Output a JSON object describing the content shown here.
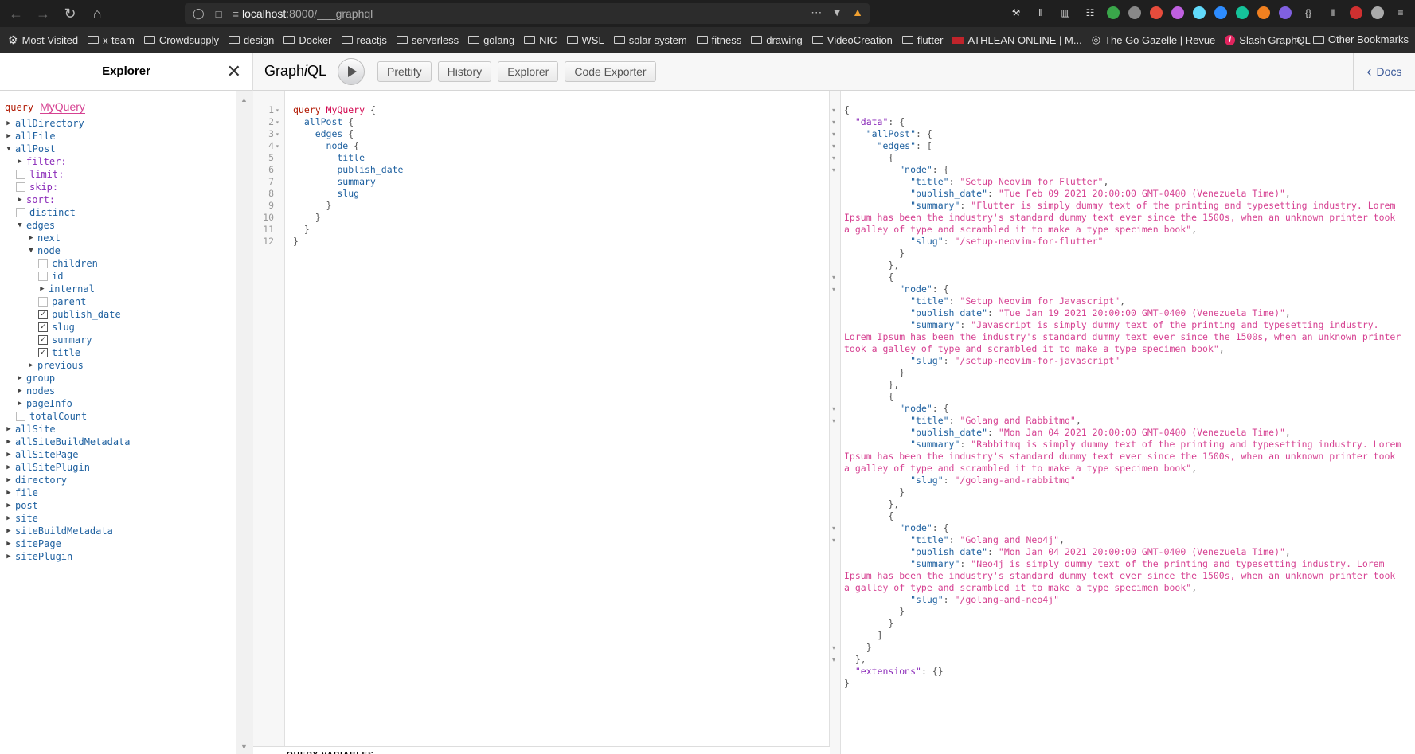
{
  "browser": {
    "url_host": "localhost",
    "url_path": ":8000/___graphql",
    "extensions": [
      "wrench-icon",
      "library-icon",
      "sidebar-icon",
      "reader-icon",
      "green-ext-icon",
      "shield-ext-icon",
      "x-ext-icon",
      "ring-ext-icon",
      "react-ext-icon",
      "zoom-ext-icon",
      "grammarly-icon",
      "orange-ext-icon",
      "purple-ext-icon",
      "json-ext-icon",
      "bars-ext-icon",
      "red-ext-icon",
      "circle-ext-icon",
      "menu-icon"
    ]
  },
  "bookmarks": {
    "items": [
      {
        "label": "Most Visited",
        "icon": "gear-icon"
      },
      {
        "label": "x-team",
        "icon": "folder-icon"
      },
      {
        "label": "Crowdsupply",
        "icon": "folder-icon"
      },
      {
        "label": "design",
        "icon": "folder-icon"
      },
      {
        "label": "Docker",
        "icon": "folder-icon"
      },
      {
        "label": "reactjs",
        "icon": "folder-icon"
      },
      {
        "label": "serverless",
        "icon": "folder-icon"
      },
      {
        "label": "golang",
        "icon": "folder-icon"
      },
      {
        "label": "NIC",
        "icon": "folder-icon"
      },
      {
        "label": "WSL",
        "icon": "folder-icon"
      },
      {
        "label": "solar system",
        "icon": "folder-icon"
      },
      {
        "label": "fitness",
        "icon": "folder-icon"
      },
      {
        "label": "drawing",
        "icon": "folder-icon"
      },
      {
        "label": "VideoCreation",
        "icon": "folder-icon"
      },
      {
        "label": "flutter",
        "icon": "folder-icon"
      },
      {
        "label": "ATHLEAN ONLINE | M...",
        "icon": "athlean-icon"
      },
      {
        "label": "The Go Gazelle | Revue",
        "icon": "globe-icon"
      },
      {
        "label": "Slash GraphQL",
        "icon": "slash-icon"
      }
    ],
    "other_label": "Other Bookmarks"
  },
  "explorer": {
    "title": "Explorer",
    "query_keyword": "query",
    "query_name": "MyQuery",
    "tree": [
      {
        "label": "allDirectory",
        "depth": 0,
        "kind": "tri",
        "open": false
      },
      {
        "label": "allFile",
        "depth": 0,
        "kind": "tri",
        "open": false
      },
      {
        "label": "allPost",
        "depth": 0,
        "kind": "tri",
        "open": true
      },
      {
        "label": "filter:",
        "depth": 1,
        "kind": "tri",
        "open": false,
        "arg": true
      },
      {
        "label": "limit:",
        "depth": 1,
        "kind": "chk",
        "checked": false,
        "arg": true
      },
      {
        "label": "skip:",
        "depth": 1,
        "kind": "chk",
        "checked": false,
        "arg": true
      },
      {
        "label": "sort:",
        "depth": 1,
        "kind": "tri",
        "open": false,
        "arg": true
      },
      {
        "label": "distinct",
        "depth": 1,
        "kind": "chk",
        "checked": false
      },
      {
        "label": "edges",
        "depth": 1,
        "kind": "tri",
        "open": true
      },
      {
        "label": "next",
        "depth": 2,
        "kind": "tri",
        "open": false
      },
      {
        "label": "node",
        "depth": 2,
        "kind": "tri",
        "open": true
      },
      {
        "label": "children",
        "depth": 3,
        "kind": "chk",
        "checked": false
      },
      {
        "label": "id",
        "depth": 3,
        "kind": "chk",
        "checked": false
      },
      {
        "label": "internal",
        "depth": 3,
        "kind": "tri",
        "open": false
      },
      {
        "label": "parent",
        "depth": 3,
        "kind": "chk",
        "checked": false
      },
      {
        "label": "publish_date",
        "depth": 3,
        "kind": "chk",
        "checked": true
      },
      {
        "label": "slug",
        "depth": 3,
        "kind": "chk",
        "checked": true
      },
      {
        "label": "summary",
        "depth": 3,
        "kind": "chk",
        "checked": true
      },
      {
        "label": "title",
        "depth": 3,
        "kind": "chk",
        "checked": true
      },
      {
        "label": "previous",
        "depth": 2,
        "kind": "tri",
        "open": false
      },
      {
        "label": "group",
        "depth": 1,
        "kind": "tri",
        "open": false
      },
      {
        "label": "nodes",
        "depth": 1,
        "kind": "tri",
        "open": false
      },
      {
        "label": "pageInfo",
        "depth": 1,
        "kind": "tri",
        "open": false
      },
      {
        "label": "totalCount",
        "depth": 1,
        "kind": "chk",
        "checked": false
      },
      {
        "label": "allSite",
        "depth": 0,
        "kind": "tri",
        "open": false
      },
      {
        "label": "allSiteBuildMetadata",
        "depth": 0,
        "kind": "tri",
        "open": false
      },
      {
        "label": "allSitePage",
        "depth": 0,
        "kind": "tri",
        "open": false
      },
      {
        "label": "allSitePlugin",
        "depth": 0,
        "kind": "tri",
        "open": false
      },
      {
        "label": "directory",
        "depth": 0,
        "kind": "tri",
        "open": false
      },
      {
        "label": "file",
        "depth": 0,
        "kind": "tri",
        "open": false
      },
      {
        "label": "post",
        "depth": 0,
        "kind": "tri",
        "open": false
      },
      {
        "label": "site",
        "depth": 0,
        "kind": "tri",
        "open": false
      },
      {
        "label": "siteBuildMetadata",
        "depth": 0,
        "kind": "tri",
        "open": false
      },
      {
        "label": "sitePage",
        "depth": 0,
        "kind": "tri",
        "open": false
      },
      {
        "label": "sitePlugin",
        "depth": 0,
        "kind": "tri",
        "open": false
      }
    ]
  },
  "toolbar": {
    "logo_a": "Graph",
    "logo_i": "i",
    "logo_b": "QL",
    "buttons": [
      "Prettify",
      "History",
      "Explorer",
      "Code Exporter"
    ],
    "docs_label": "Docs"
  },
  "editor": {
    "lines": [
      {
        "n": "1",
        "fold": true,
        "parts": [
          [
            "kw",
            "query "
          ],
          [
            "def",
            "MyQuery"
          ],
          [
            "punc",
            " {"
          ]
        ]
      },
      {
        "n": "2",
        "fold": true,
        "parts": [
          [
            "prop",
            "  allPost"
          ],
          [
            "punc",
            " {"
          ]
        ]
      },
      {
        "n": "3",
        "fold": true,
        "parts": [
          [
            "prop",
            "    edges"
          ],
          [
            "punc",
            " {"
          ]
        ]
      },
      {
        "n": "4",
        "fold": true,
        "parts": [
          [
            "prop",
            "      node"
          ],
          [
            "punc",
            " {"
          ]
        ]
      },
      {
        "n": "5",
        "fold": false,
        "parts": [
          [
            "prop",
            "        title"
          ]
        ]
      },
      {
        "n": "6",
        "fold": false,
        "parts": [
          [
            "prop",
            "        publish_date"
          ]
        ]
      },
      {
        "n": "7",
        "fold": false,
        "parts": [
          [
            "prop",
            "        summary"
          ]
        ]
      },
      {
        "n": "8",
        "fold": false,
        "parts": [
          [
            "prop",
            "        slug"
          ]
        ]
      },
      {
        "n": "9",
        "fold": false,
        "parts": [
          [
            "punc",
            "      }"
          ]
        ]
      },
      {
        "n": "10",
        "fold": false,
        "parts": [
          [
            "punc",
            "    }"
          ]
        ]
      },
      {
        "n": "11",
        "fold": false,
        "parts": [
          [
            "punc",
            "  }"
          ]
        ]
      },
      {
        "n": "12",
        "fold": false,
        "parts": [
          [
            "punc",
            "}"
          ]
        ]
      }
    ],
    "variables_label": "QUERY VARIABLES"
  },
  "result": {
    "posts": [
      {
        "title": "Setup Neovim for Flutter",
        "publish_date": "Tue Feb 09 2021 20:00:00 GMT-0400 (Venezuela Time)",
        "summary": "Flutter is simply dummy text of the printing and typesetting industry. Lorem Ipsum has been the industry's standard dummy text ever since the 1500s, when an unknown printer took a galley of type and scrambled it to make a type specimen book",
        "slug": "/setup-neovim-for-flutter"
      },
      {
        "title": "Setup Neovim for Javascript",
        "publish_date": "Tue Jan 19 2021 20:00:00 GMT-0400 (Venezuela Time)",
        "summary": "Javascript is simply dummy text of the printing and typesetting industry. Lorem Ipsum has been the industry's standard dummy text ever since the 1500s, when an unknown printer took a galley of type and scrambled it to make a type specimen book",
        "slug": "/setup-neovim-for-javascript"
      },
      {
        "title": "Golang and Rabbitmq",
        "publish_date": "Mon Jan 04 2021 20:00:00 GMT-0400 (Venezuela Time)",
        "summary": "Rabbitmq is simply dummy text of the printing and typesetting industry. Lorem Ipsum has been the industry's standard dummy text ever since the 1500s, when an unknown printer took a galley of type and scrambled it to make a type specimen book",
        "slug": "/golang-and-rabbitmq"
      },
      {
        "title": "Golang and Neo4j",
        "publish_date": "Mon Jan 04 2021 20:00:00 GMT-0400 (Venezuela Time)",
        "summary": "Neo4j is simply dummy text of the printing and typesetting industry. Lorem Ipsum has been the industry's standard dummy text ever since the 1500s, when an unknown printer took a galley of type and scrambled it to make a type specimen book",
        "slug": "/golang-and-neo4j"
      }
    ]
  }
}
